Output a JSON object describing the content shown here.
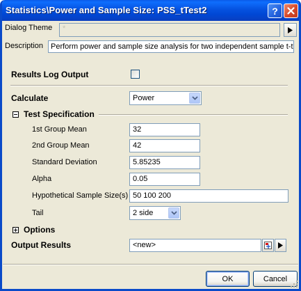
{
  "window": {
    "title": "Statistics\\Power and Sample Size: PSS_tTest2"
  },
  "theme": {
    "label": "Dialog Theme",
    "value": "*"
  },
  "description": {
    "label": "Description",
    "text": "Perform power and sample size analysis for two independent sample t-test."
  },
  "results_log": {
    "label": "Results Log Output",
    "checked": false
  },
  "calculate": {
    "label": "Calculate",
    "value": "Power"
  },
  "test_spec": {
    "label": "Test Specification",
    "expanded": true,
    "fields": [
      {
        "label": "1st Group Mean",
        "value": "32"
      },
      {
        "label": "2nd Group Mean",
        "value": "42"
      },
      {
        "label": "Standard Deviation",
        "value": "5.85235"
      },
      {
        "label": "Alpha",
        "value": "0.05"
      },
      {
        "label": "Hypothetical Sample Size(s)",
        "value": "50 100 200"
      }
    ],
    "tail": {
      "label": "Tail",
      "value": "2 side"
    }
  },
  "options": {
    "label": "Options",
    "expanded": false
  },
  "output": {
    "label": "Output Results",
    "value": "<new>"
  },
  "buttons": {
    "ok": "OK",
    "cancel": "Cancel"
  }
}
